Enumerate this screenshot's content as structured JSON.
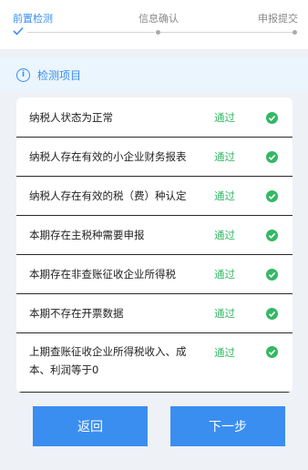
{
  "stepper": {
    "steps": [
      {
        "label": "前置检测",
        "state": "active"
      },
      {
        "label": "信息确认",
        "state": "pending"
      },
      {
        "label": "申报提交",
        "state": "pending"
      }
    ]
  },
  "section": {
    "title": "检测项目",
    "icon": "info-icon"
  },
  "checks": [
    {
      "label": "纳税人状态为正常",
      "status": "通过"
    },
    {
      "label": "纳税人存在有效的小企业财务报表",
      "status": "通过"
    },
    {
      "label": "纳税人存在有效的税（费）种认定",
      "status": "通过"
    },
    {
      "label": "本期存在主税种需要申报",
      "status": "通过"
    },
    {
      "label": "本期存在非查账征收企业所得税",
      "status": "通过"
    },
    {
      "label": "本期不存在开票数据",
      "status": "通过"
    },
    {
      "label": "上期查账征收企业所得税收入、成本、利润等于0",
      "status": "通过"
    }
  ],
  "buttons": {
    "back": "返回",
    "next": "下一步"
  },
  "colors": {
    "accent": "#3a8ef0",
    "pass": "#34b865",
    "header_bg": "#eaf5fd",
    "page_bg": "#eef1f6"
  }
}
